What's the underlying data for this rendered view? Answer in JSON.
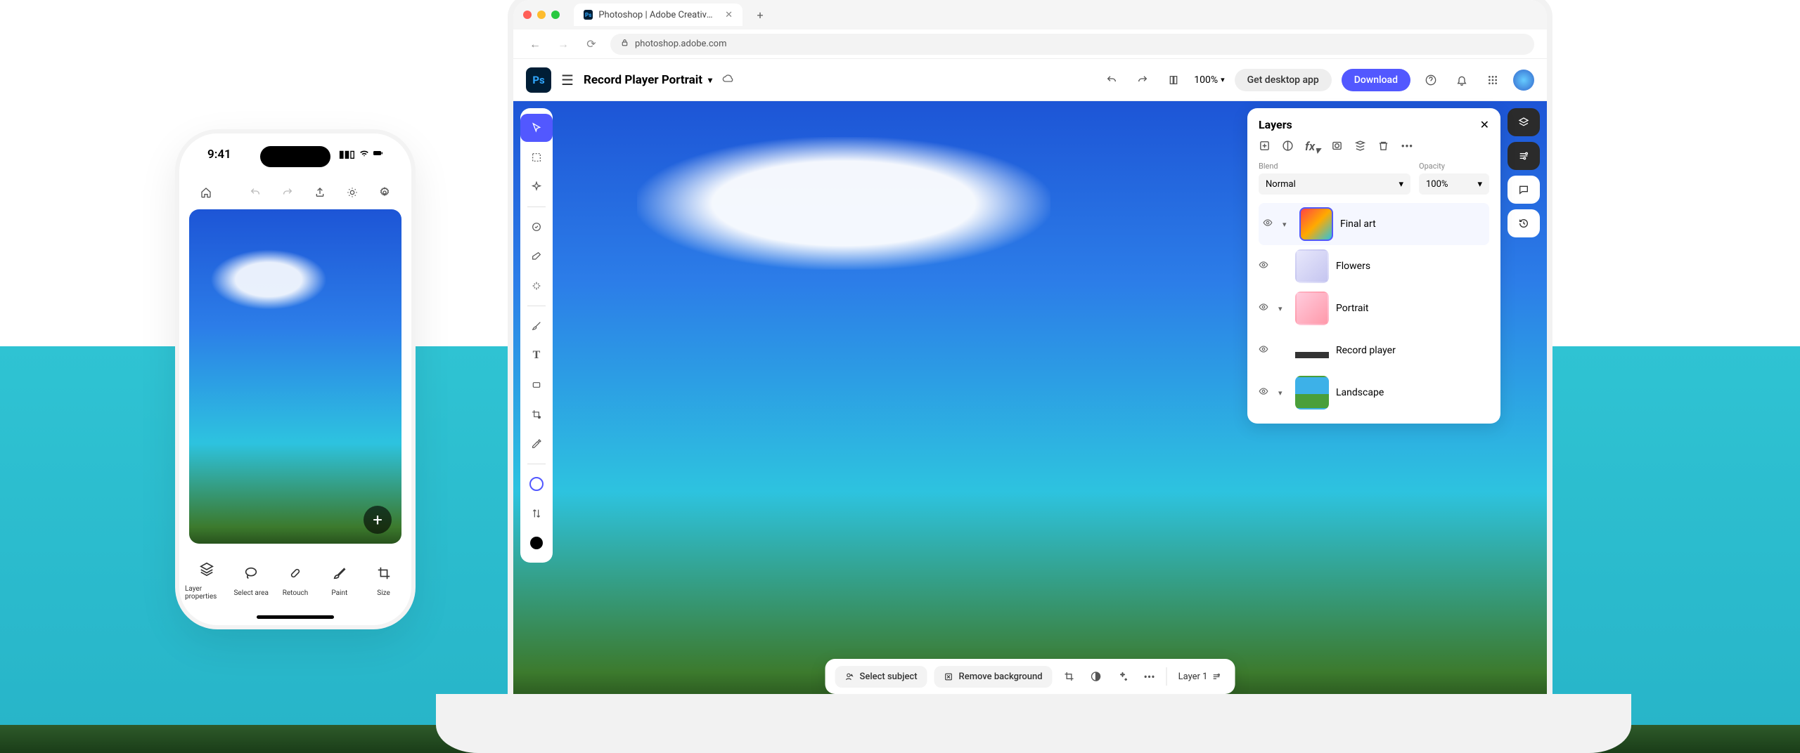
{
  "background": {
    "band_color": "#2fc3d3"
  },
  "phone": {
    "time": "9:41",
    "signal": "••••",
    "wifi": "wifi",
    "battery": "battery",
    "bottom_actions": [
      {
        "id": "layer-properties",
        "label": "Layer properties"
      },
      {
        "id": "select-area",
        "label": "Select area"
      },
      {
        "id": "retouch",
        "label": "Retouch"
      },
      {
        "id": "paint",
        "label": "Paint"
      },
      {
        "id": "size",
        "label": "Size"
      }
    ]
  },
  "browser": {
    "tab_title": "Photoshop | Adobe Creative C",
    "url": "photoshop.adobe.com"
  },
  "app_toolbar": {
    "document_name": "Record Player Portrait",
    "zoom": "100%",
    "get_desktop_label": "Get desktop app",
    "download_label": "Download"
  },
  "layers_panel": {
    "title": "Layers",
    "blend_label": "Blend",
    "blend_value": "Normal",
    "opacity_label": "Opacity",
    "opacity_value": "100%",
    "layers": [
      {
        "id": "final-art",
        "name": "Final art",
        "thumb": "th-final",
        "selected": true,
        "expandable": true
      },
      {
        "id": "flowers",
        "name": "Flowers",
        "thumb": "th-flowers",
        "selected": false,
        "expandable": false
      },
      {
        "id": "portrait",
        "name": "Portrait",
        "thumb": "th-portrait",
        "selected": false,
        "expandable": true
      },
      {
        "id": "record-player",
        "name": "Record player",
        "thumb": "th-record",
        "selected": false,
        "expandable": false
      },
      {
        "id": "landscape",
        "name": "Landscape",
        "thumb": "th-landscape",
        "selected": false,
        "expandable": true
      }
    ]
  },
  "context_bar": {
    "select_subject": "Select subject",
    "remove_background": "Remove background",
    "current_layer": "Layer 1"
  },
  "tools": [
    "move",
    "magic-wand",
    "generative",
    "spot-heal",
    "clone",
    "brush",
    "text",
    "shape",
    "crop",
    "eyedropper"
  ]
}
